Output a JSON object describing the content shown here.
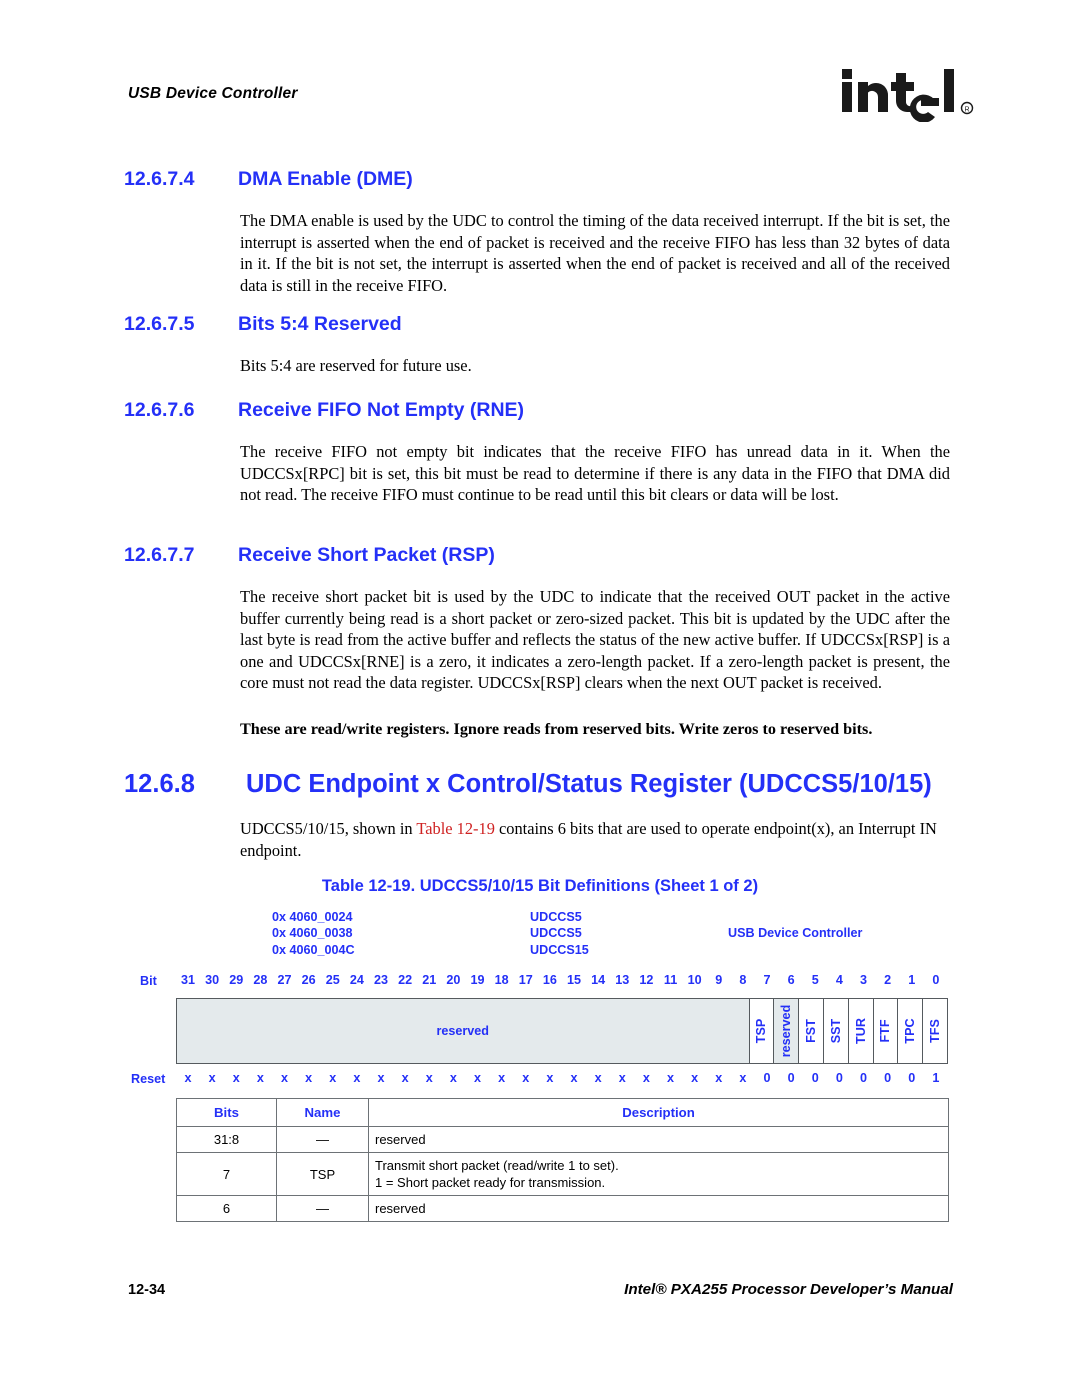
{
  "header": {
    "running_head": "USB Device Controller",
    "logo_text": "intel",
    "logo_mark": "registered-trademark"
  },
  "sections": [
    {
      "number": "12.6.7.4",
      "title": "DMA Enable (DME)",
      "body": "The DMA enable is used by the UDC to control the timing of the data received interrupt. If the bit is set, the interrupt is asserted when the end of packet is received and the receive FIFO has less than 32 bytes of data in it. If the bit is not set, the interrupt is asserted when the end of packet is received and all of the received data is still in the receive FIFO."
    },
    {
      "number": "12.6.7.5",
      "title": "Bits 5:4 Reserved",
      "body": "Bits 5:4 are reserved for future use."
    },
    {
      "number": "12.6.7.6",
      "title": "Receive FIFO Not Empty (RNE)",
      "body": "The receive FIFO not empty bit indicates that the receive FIFO has unread data in it. When the UDCCSx[RPC] bit is set, this bit must be read to determine if there is any data in the FIFO that DMA did not read. The receive FIFO must continue to be read until this bit clears or data will be lost."
    },
    {
      "number": "12.6.7.7",
      "title": "Receive Short Packet (RSP)",
      "body": "The receive short packet bit is used by the UDC to indicate that the received OUT packet in the active buffer currently being read is a short packet or zero-sized packet. This bit is updated by the UDC after the last byte is read from the active buffer and reflects the status of the new active buffer. If UDCCSx[RSP] is a one and UDCCSx[RNE] is a zero, it indicates a zero-length packet. If a zero-length packet is present, the core must not read the data register. UDCCSx[RSP] clears when the next OUT packet is received."
    }
  ],
  "note": "These are read/write registers. Ignore reads from reserved bits. Write zeros to reserved bits.",
  "main_section": {
    "number": "12.6.8",
    "title": "UDC Endpoint x Control/Status Register (UDCCS5/10/15)",
    "intro_before": "UDCCS5/10/15, shown in ",
    "intro_link": "Table 12-19",
    "intro_after": " contains 6 bits that are used to operate endpoint(x), an Interrupt IN endpoint."
  },
  "table_caption": "Table 12-19. UDCCS5/10/15 Bit Definitions (Sheet 1 of 2)",
  "register": {
    "addresses": [
      {
        "address": "0x 4060_0024",
        "name": "UDCCS5",
        "unit": ""
      },
      {
        "address": "0x 4060_0038",
        "name": "UDCCS5",
        "unit": "USB Device Controller"
      },
      {
        "address": "0x 4060_004C",
        "name": "UDCCS15",
        "unit": ""
      }
    ],
    "bit_row_label": "Bit",
    "bit_numbers": [
      31,
      30,
      29,
      28,
      27,
      26,
      25,
      24,
      23,
      22,
      21,
      20,
      19,
      18,
      17,
      16,
      15,
      14,
      13,
      12,
      11,
      10,
      9,
      8,
      7,
      6,
      5,
      4,
      3,
      2,
      1,
      0
    ],
    "fields": [
      {
        "label": "reserved",
        "bits": 24,
        "orientation": "horizontal",
        "shaded": true
      },
      {
        "label": "TSP",
        "bits": 1,
        "orientation": "vertical",
        "shaded": false
      },
      {
        "label": "reserved",
        "bits": 1,
        "orientation": "vertical",
        "shaded": true
      },
      {
        "label": "FST",
        "bits": 1,
        "orientation": "vertical",
        "shaded": false
      },
      {
        "label": "SST",
        "bits": 1,
        "orientation": "vertical",
        "shaded": false
      },
      {
        "label": "TUR",
        "bits": 1,
        "orientation": "vertical",
        "shaded": false
      },
      {
        "label": "FTF",
        "bits": 1,
        "orientation": "vertical",
        "shaded": false
      },
      {
        "label": "TPC",
        "bits": 1,
        "orientation": "vertical",
        "shaded": false
      },
      {
        "label": "TFS",
        "bits": 1,
        "orientation": "vertical",
        "shaded": false
      }
    ],
    "reset_row_label": "Reset",
    "reset_values": [
      "x",
      "x",
      "x",
      "x",
      "x",
      "x",
      "x",
      "x",
      "x",
      "x",
      "x",
      "x",
      "x",
      "x",
      "x",
      "x",
      "x",
      "x",
      "x",
      "x",
      "x",
      "x",
      "x",
      "x",
      "0",
      "0",
      "0",
      "0",
      "0",
      "0",
      "0",
      "1"
    ]
  },
  "bit_table": {
    "headers": [
      "Bits",
      "Name",
      "Description"
    ],
    "rows": [
      {
        "bits": "31:8",
        "name": "—",
        "description": "reserved"
      },
      {
        "bits": "7",
        "name": "TSP",
        "description": "Transmit short packet (read/write 1 to set).\n1 =  Short packet ready for transmission."
      },
      {
        "bits": "6",
        "name": "—",
        "description": "reserved"
      }
    ]
  },
  "footer": {
    "page_number": "12-34",
    "manual_title": "Intel® PXA255 Processor Developer’s Manual"
  },
  "colors": {
    "heading_blue": "#2430f7",
    "xref_red": "#cf2222",
    "rule_gray": "#6d7276",
    "cell_shade": "#e4eaec"
  }
}
